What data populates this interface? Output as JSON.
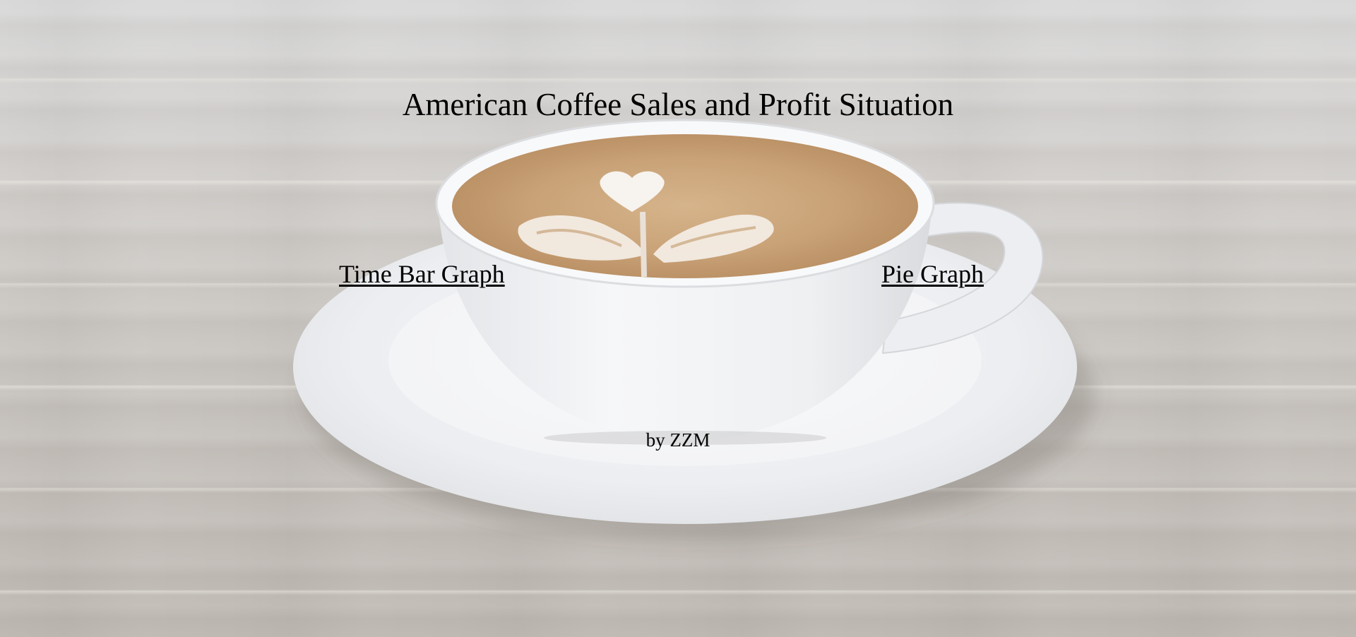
{
  "page": {
    "title": "American Coffee Sales and Profit Situation",
    "links": {
      "time_bar_graph": "Time Bar Graph",
      "pie_graph": "Pie Graph"
    },
    "byline": "by ZZM"
  },
  "background": {
    "subject": "latte-art-coffee-cup-on-wooden-table",
    "colors": {
      "table": "#cfcbc6",
      "cup": "#f2f3f5",
      "coffee": "#c8a47a",
      "foam": "#f7f3ee"
    }
  }
}
